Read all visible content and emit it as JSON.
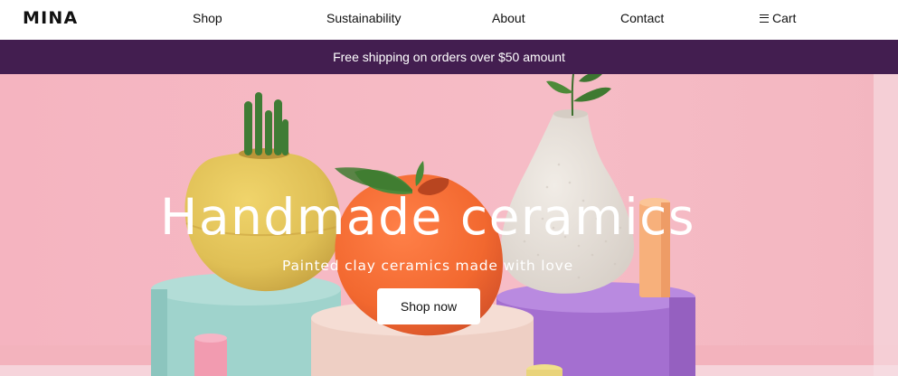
{
  "nav": {
    "logo": "MINA",
    "links": [
      {
        "label": "Shop"
      },
      {
        "label": "Sustainability"
      },
      {
        "label": "About"
      },
      {
        "label": "Contact"
      }
    ],
    "cart_label": "Cart",
    "cart_icon": "menu-icon"
  },
  "banner": {
    "text": "Free shipping on orders over $50 amount"
  },
  "hero": {
    "title": "Handmade ceramics",
    "subtitle": "Painted clay ceramics made with love",
    "cta_label": "Shop now",
    "colors": {
      "background": "#f4b7c2",
      "banner": "#431e50",
      "yellow_vase": "#e2c35a",
      "orange_vase": "#f26a35",
      "white_vase": "#e6e0d8",
      "teal_pedestal": "#9fd3cc",
      "lilac_pedestal": "#a46fd0",
      "beige_pedestal": "#eecfc4"
    }
  }
}
